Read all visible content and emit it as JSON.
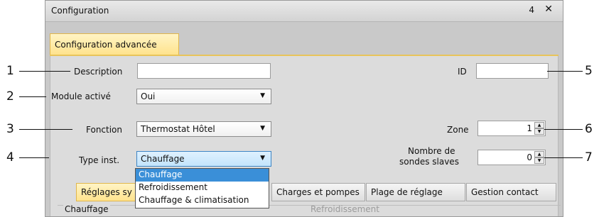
{
  "window": {
    "title": "Configuration",
    "pin_glyph": "p",
    "close_glyph": "×"
  },
  "main_tab": {
    "label": "Configuration advancée"
  },
  "form": {
    "description": {
      "label": "Description",
      "value": ""
    },
    "id": {
      "label": "ID",
      "value": ""
    },
    "module": {
      "label": "Module activé",
      "value": "Oui"
    },
    "fonction": {
      "label": "Fonction",
      "value": "Thermostat Hôtel"
    },
    "zone": {
      "label": "Zone",
      "value": "1"
    },
    "type_inst": {
      "label": "Type inst.",
      "value": "Chauffage"
    },
    "slaves": {
      "label_line1": "Nombre de",
      "label_line2": "sondes slaves",
      "value": "0"
    }
  },
  "dropdown_options": [
    "Chauffage",
    "Refroidissement",
    "Chauffage & climatisation"
  ],
  "tabs": [
    "Réglages sy",
    "Charges et pompes",
    "Plage de réglage",
    "Gestion contact"
  ],
  "groups": {
    "left": "Chauffage",
    "right": "Refroidissement"
  },
  "callouts": [
    "1",
    "2",
    "3",
    "4",
    "5",
    "6",
    "7"
  ],
  "colors": {
    "accent": "#ffe38d",
    "selection": "#3a8fd8"
  }
}
